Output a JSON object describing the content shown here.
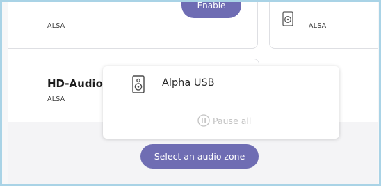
{
  "cards": {
    "top_left": {
      "subtitle": "ALSA",
      "button_label": "Enable"
    },
    "top_right": {
      "subtitle": "ALSA"
    },
    "middle_left": {
      "title": "HD-Audio",
      "subtitle": "ALSA"
    }
  },
  "popup": {
    "device_name": "Alpha USB",
    "device_icon": "speaker-icon",
    "pause_label": "Pause all",
    "pause_icon": "pause-icon"
  },
  "footer": {
    "zone_button_label": "Select an audio zone"
  },
  "colors": {
    "accent": "#6e6cb3",
    "frame_border": "#a9d3e6"
  }
}
